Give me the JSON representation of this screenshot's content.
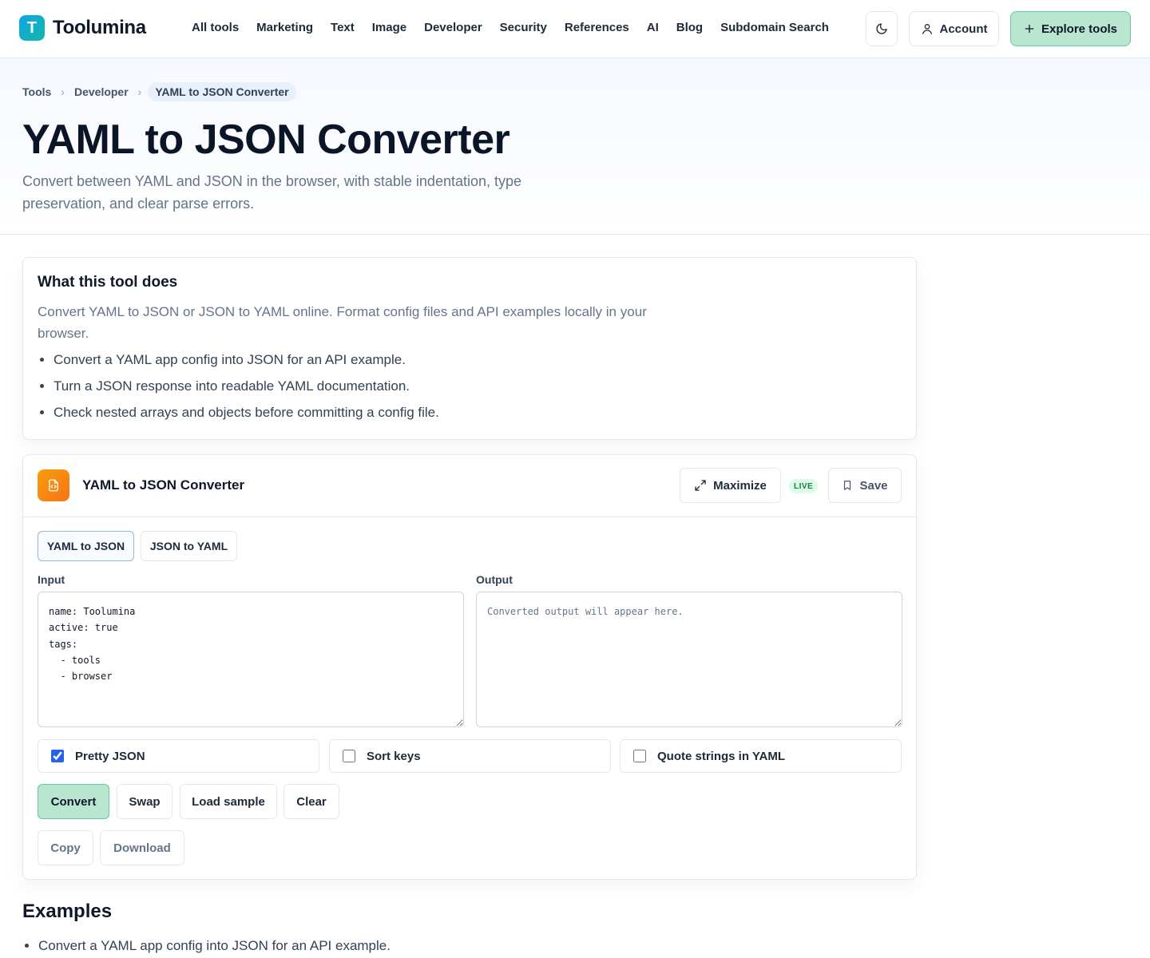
{
  "brand": {
    "logo_letter": "T",
    "name": "Toolumina"
  },
  "nav": {
    "items": [
      "All tools",
      "Marketing",
      "Text",
      "Image",
      "Developer",
      "Security",
      "References",
      "AI",
      "Blog",
      "Subdomain Search"
    ]
  },
  "header_actions": {
    "theme_icon": "moon-icon",
    "account_label": "Account",
    "explore_label": "Explore tools"
  },
  "breadcrumb": [
    "Tools",
    "Developer",
    "YAML to JSON Converter"
  ],
  "page": {
    "title": "YAML to JSON Converter",
    "subtitle": "Convert between YAML and JSON in the browser, with stable indentation, type preservation, and clear parse errors."
  },
  "info": {
    "heading": "What this tool does",
    "description": "Convert YAML to JSON or JSON to YAML online. Format config files and API examples locally in your browser.",
    "bullets": [
      "Convert a YAML app config into JSON for an API example.",
      "Turn a JSON response into readable YAML documentation.",
      "Check nested arrays and objects before committing a config file."
    ]
  },
  "tool": {
    "name": "YAML to JSON Converter",
    "maximize_label": "Maximize",
    "live_badge": "LIVE",
    "save_label": "Save",
    "modes": [
      "YAML to JSON",
      "JSON to YAML"
    ],
    "active_mode": "YAML to JSON",
    "input_label": "Input",
    "output_label": "Output",
    "input_value": "name: Toolumina\nactive: true\ntags:\n  - tools\n  - browser",
    "output_value": "",
    "output_placeholder": "Converted output will appear here.",
    "options": [
      {
        "label": "Pretty JSON",
        "checked": true
      },
      {
        "label": "Sort keys",
        "checked": false
      },
      {
        "label": "Quote strings in YAML",
        "checked": false
      }
    ],
    "buttons": {
      "convert": "Convert",
      "swap": "Swap",
      "load_sample": "Load sample",
      "clear": "Clear",
      "copy": "Copy",
      "download": "Download"
    }
  },
  "examples": {
    "heading": "Examples",
    "items": [
      "Convert a YAML app config into JSON for an API example."
    ]
  },
  "colors": {
    "accent": "#b8e6cf",
    "accent_border": "#6cc79b",
    "live_bg": "#dcfce7",
    "live_text": "#15803d"
  }
}
